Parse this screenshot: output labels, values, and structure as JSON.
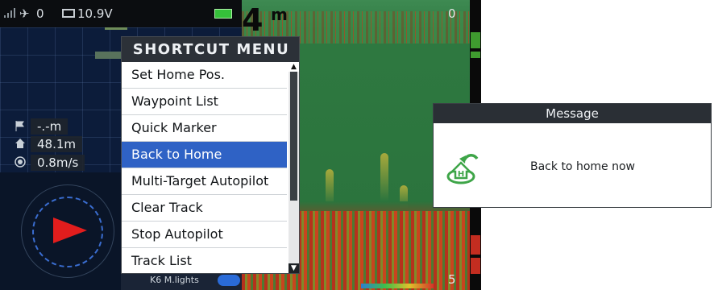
{
  "status": {
    "satellites": "0",
    "battery_voltage": "10.9V"
  },
  "map": {
    "waypoint_distance": "-.-m",
    "home_distance": "48.1m",
    "speed": "0.8m/s"
  },
  "sonar": {
    "depth_value": "4",
    "depth_unit": "m",
    "scale_top": "0",
    "scale_bottom": "5"
  },
  "lights": {
    "label": "K6  M.lights",
    "enabled": true
  },
  "shortcut_menu": {
    "title": "SHORTCUT MENU",
    "items": [
      {
        "label": "Set Home Pos."
      },
      {
        "label": "Waypoint List"
      },
      {
        "label": "Quick Marker"
      },
      {
        "label": "Back to Home",
        "selected": true
      },
      {
        "label": "Multi-Target Autopilot"
      },
      {
        "label": "Clear Track"
      },
      {
        "label": "Stop Autopilot"
      },
      {
        "label": "Track List"
      }
    ],
    "scroll_up_glyph": "▲",
    "scroll_down_glyph": "▼"
  },
  "message_dialog": {
    "title": "Message",
    "icon": "back-to-home-icon",
    "text": "Back to home now"
  },
  "colors": {
    "selected_item": "#2f62c5",
    "header": "#2c3138",
    "home_icon": "#3ea548"
  }
}
